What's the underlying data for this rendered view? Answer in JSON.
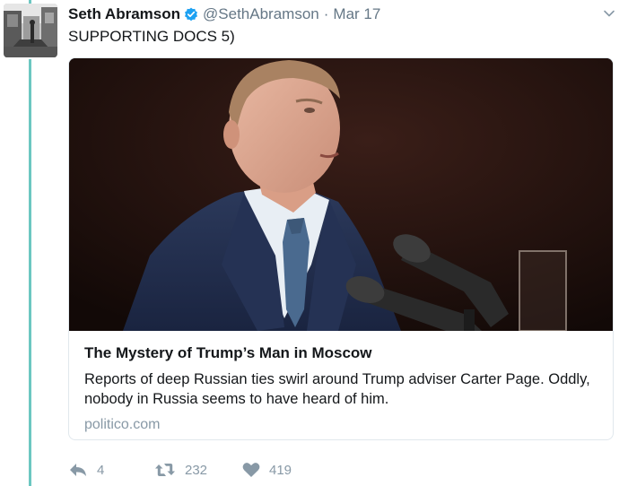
{
  "author": {
    "name": "Seth Abramson",
    "handle": "@SethAbramson",
    "separator": "·",
    "date": "Mar 17"
  },
  "icons": {
    "verified": "verified-badge-icon",
    "caret": "chevron-down-icon",
    "reply": "reply-icon",
    "retweet": "retweet-icon",
    "like": "heart-icon"
  },
  "tweet": {
    "text": "SUPPORTING DOCS 5)"
  },
  "card": {
    "title": "The Mystery of Trump’s Man in Moscow",
    "description": "Reports of deep Russian ties swirl around Trump adviser Carter Page. Oddly, nobody in Russia seems to have heard of him.",
    "domain": "politico.com"
  },
  "actions": {
    "reply_count": "4",
    "retweet_count": "232",
    "like_count": "419"
  },
  "colors": {
    "thread_line": "#6cc7c1",
    "verified": "#1da1f2",
    "muted": "#657786",
    "icon": "#8899a6"
  }
}
